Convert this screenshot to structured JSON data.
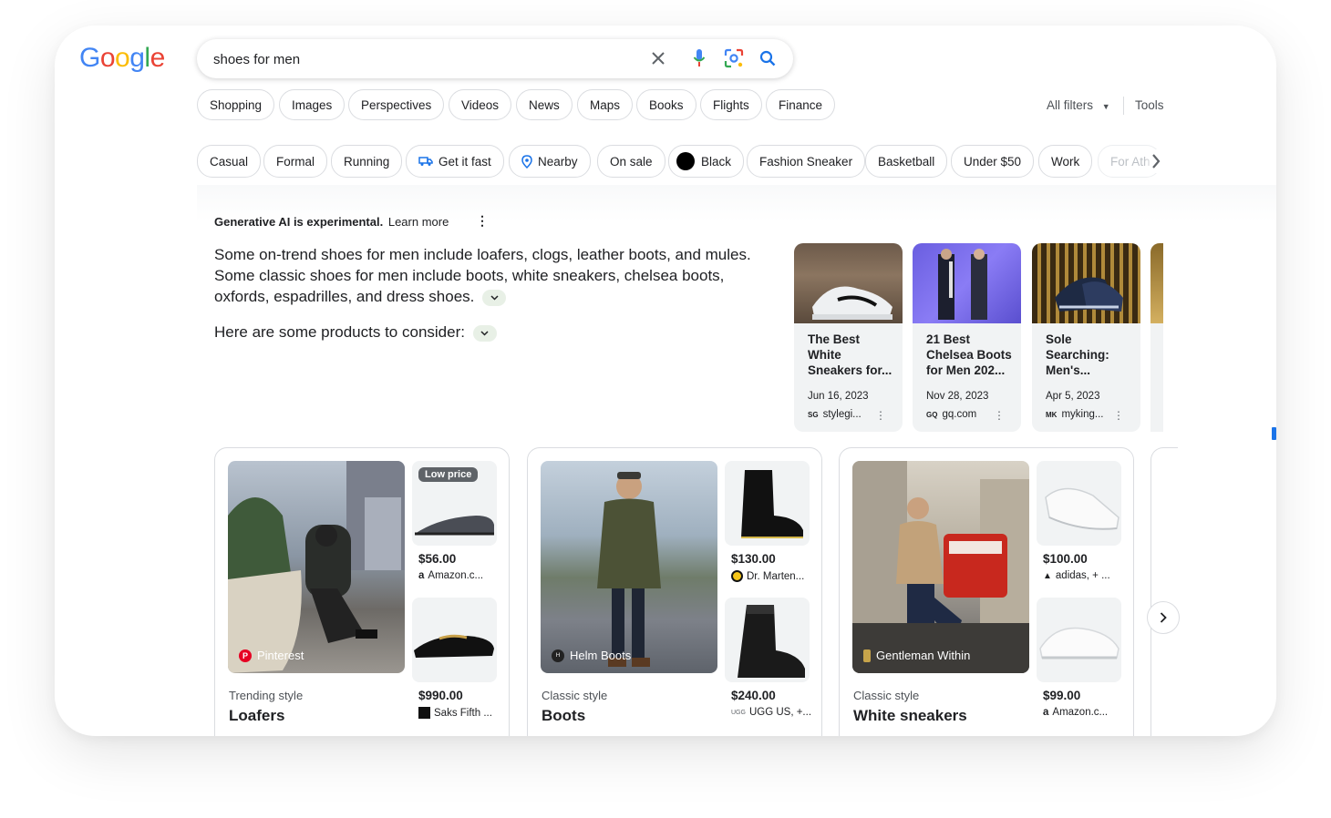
{
  "logo": {
    "letters": [
      "G",
      "o",
      "o",
      "g",
      "l",
      "e"
    ],
    "colors": [
      "#4285f4",
      "#ea4335",
      "#fbbc05",
      "#4285f4",
      "#34a853",
      "#ea4335"
    ]
  },
  "search": {
    "query": "shoes for men"
  },
  "nav_tabs": [
    "Shopping",
    "Images",
    "Perspectives",
    "Videos",
    "News",
    "Maps",
    "Books",
    "Flights",
    "Finance"
  ],
  "tools": {
    "all_filters": "All filters",
    "tools": "Tools"
  },
  "filters": [
    "Casual",
    "Formal",
    "Running",
    "Get it fast",
    "Nearby",
    "On sale",
    "Black",
    "Fashion Sneaker",
    "Basketball",
    "Under $50",
    "Work",
    "For Ath"
  ],
  "ai": {
    "label": "Generative AI is experimental.",
    "learn_more": "Learn more",
    "summary": "Some on-trend shoes for men include loafers, clogs, leather boots, and mules. Some classic shoes for men include boots, white sneakers, chelsea boots, oxfords, espadrilles, and dress shoes.",
    "products_intro": "Here are some products to consider:"
  },
  "articles": [
    {
      "title": "The Best White Sneakers for...",
      "date": "Jun 16, 2023",
      "source": "stylegi...",
      "source_icon": "SG"
    },
    {
      "title": "21 Best Chelsea Boots for Men 202...",
      "date": "Nov 28, 2023",
      "source": "gq.com",
      "source_icon": "GQ"
    },
    {
      "title": "Sole Searching: Men's...",
      "date": "Apr 5, 2023",
      "source": "myking...",
      "source_icon": "MK"
    }
  ],
  "product_groups": [
    {
      "style_label": "Trending style",
      "title": "Loafers",
      "image_source": "Pinterest",
      "items": [
        {
          "badge": "Low price",
          "price": "$56.00",
          "seller": "Amazon.c..."
        },
        {
          "price": "$990.00",
          "seller": "Saks Fifth ..."
        }
      ]
    },
    {
      "style_label": "Classic style",
      "title": "Boots",
      "image_source": "Helm Boots",
      "items": [
        {
          "price": "$130.00",
          "seller": "Dr. Marten..."
        },
        {
          "price": "$240.00",
          "seller": "UGG US, +..."
        }
      ]
    },
    {
      "style_label": "Classic style",
      "title": "White sneakers",
      "image_source": "Gentleman Within",
      "items": [
        {
          "price": "$100.00",
          "seller": "adidas, + ..."
        },
        {
          "price": "$99.00",
          "seller": "Amazon.c..."
        }
      ]
    }
  ],
  "colors": {
    "accent_blue": "#1a73e8",
    "chip_border": "#dadce0",
    "text_gray": "#4d5156"
  }
}
